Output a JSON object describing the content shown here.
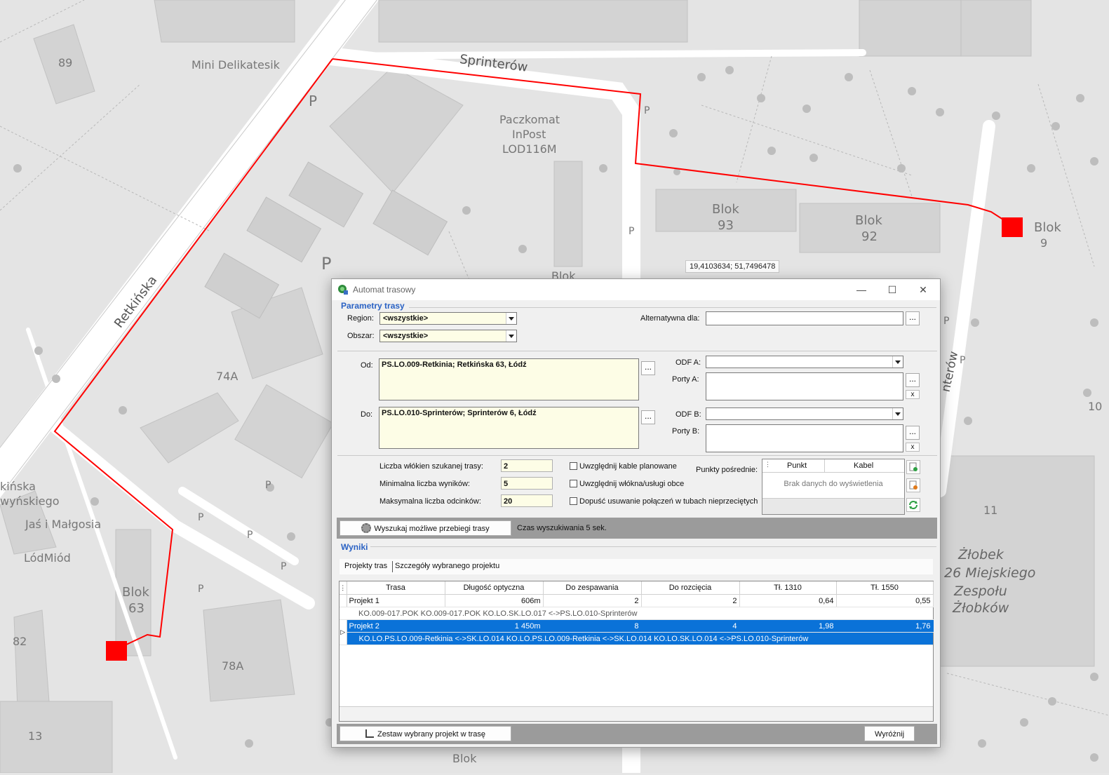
{
  "map": {
    "labels": {
      "n89": "89",
      "mini": "Mini Delikatesik",
      "sprinterow": "Sprinterów",
      "paczkomat1": "Paczkomat",
      "paczkomat2": "InPost",
      "paczkomat3": "LOD116M",
      "retkinska": "Retkińska",
      "blok93a": "Blok",
      "blok93b": "93",
      "blok92a": "Blok",
      "blok92b": "92",
      "blok9a": "Blok",
      "blok9b": "9",
      "n74a": "74A",
      "jas": "Jaś i Małgosia",
      "lodmiod": "LódMiód",
      "blok63a": "Blok",
      "blok63b": "63",
      "n82": "82",
      "n78a": "78A",
      "n13": "13",
      "blokbottom": "Blok",
      "n11": "11",
      "zlobek1": "Żłobek",
      "zlobek2": "26 Miejskiego",
      "zlobek3": "Zespołu",
      "zlobek4": "Żłobków",
      "kinska": "kińska",
      "wynskiego": "wyńskiego",
      "n10": "10",
      "blokmid": "Blok",
      "sprinterow_v": "nterów"
    },
    "coord_readout": "19,4103634; 51,7496478",
    "route_color": "#ff0000"
  },
  "dialog": {
    "title": "Automat trasowy",
    "params_section": "Parametry trasy",
    "region_label": "Region:",
    "region_value": "<wszystkie>",
    "obszar_label": "Obszar:",
    "obszar_value": "<wszystkie>",
    "alt_label": "Alternatywna dla:",
    "alt_value": "",
    "od_label": "Od:",
    "od_value": "PS.LO.009-Retkinia; Retkińska 63, Łódź",
    "do_label": "Do:",
    "do_value": "PS.LO.010-Sprinterów; Sprinterów 6, Łódź",
    "odfa_label": "ODF A:",
    "portya_label": "Porty A:",
    "odfb_label": "ODF B:",
    "portyb_label": "Porty B:",
    "dots": "...",
    "x": "x",
    "fibers_label": "Liczba włókien szukanej trasy:",
    "fibers_value": "2",
    "minres_label": "Minimalna liczba wyników:",
    "minres_value": "5",
    "maxseg_label": "Maksymalna liczba odcinków:",
    "maxseg_value": "20",
    "chk1": "Uwzględnij kable planowane",
    "chk2": "Uwzględnij włókna/usługi obce",
    "chk3": "Dopuść usuwanie połączeń w tubach nieprzeciętych",
    "via_label": "Punkty pośrednie:",
    "via_col1": "Punkt",
    "via_col2": "Kabel",
    "via_empty": "Brak danych do wyświetlenia",
    "search_button": "Wyszukaj możliwe przebiegi trasy",
    "search_time": "Czas wyszukiwania 5 sek.",
    "results_section": "Wyniki",
    "tab1": "Projekty tras",
    "tab2": "Szczegóły wybranego projektu",
    "columns": [
      "Trasa",
      "Długość optyczna",
      "Do zespawania",
      "Do rozcięcia",
      "Tł. 1310",
      "Tł. 1550"
    ],
    "rows": [
      {
        "trasa": "Projekt 1",
        "dlugosc": "606m",
        "zespawania": "2",
        "rozciecia": "2",
        "t1310": "0,64",
        "t1550": "0,55",
        "detail": "KO.009-017.POK KO.009-017.POK KO.LO.SK.LO.017 <->PS.LO.010-Sprinterów"
      },
      {
        "trasa": "Projekt 2",
        "dlugosc": "1 450m",
        "zespawania": "8",
        "rozciecia": "4",
        "t1310": "1,98",
        "t1550": "1,76",
        "detail": "KO.LO.PS.LO.009-Retkinia <->SK.LO.014 KO.LO.PS.LO.009-Retkinia <->SK.LO.014 KO.LO.SK.LO.014 <->PS.LO.010-Sprinterów"
      }
    ],
    "apply_button": "Zestaw wybrany projekt w trasę",
    "highlight_button": "Wyróżnij"
  }
}
